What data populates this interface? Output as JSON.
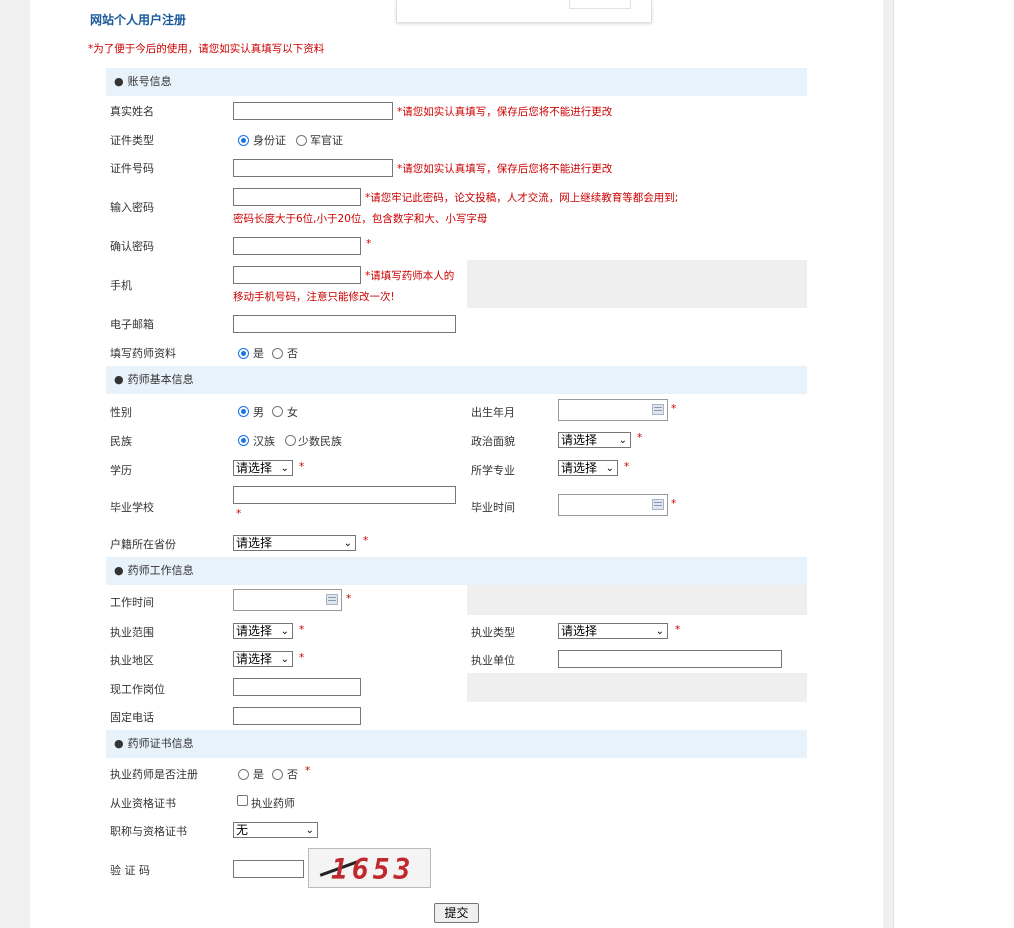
{
  "title": "网站个人用户注册",
  "notice": "*为了便于今后的使用，请您如实认真填写以下资料",
  "sections": {
    "account": "账号信息",
    "basic": "药师基本信息",
    "work": "药师工作信息",
    "cert": "药师证书信息"
  },
  "account": {
    "real_name_label": "真实姓名",
    "real_name_note": "*请您如实认真填写，保存后您将不能进行更改",
    "id_type_label": "证件类型",
    "id_type_options": [
      "身份证",
      "军官证"
    ],
    "id_number_label": "证件号码",
    "id_number_note": "*请您如实认真填写，保存后您将不能进行更改",
    "password_label": "输入密码",
    "password_note_1": "*请您牢记此密码，论文投稿，人才交流，网上继续教育等都会用到;",
    "password_note_2": "密码长度大于6位,小于20位，包含数字和大、小写字母",
    "confirm_label": "确认密码",
    "confirm_note": "*",
    "mobile_label": "手机",
    "mobile_note_1": "*请填写药师本人的",
    "mobile_note_2": "移动手机号码，注意只能修改一次!",
    "email_label": "电子邮箱",
    "pharmacist_info_label": "填写药师资料",
    "pharmacist_info_options": [
      "是",
      "否"
    ]
  },
  "basic": {
    "gender_label": "性别",
    "gender_options": [
      "男",
      "女"
    ],
    "birth_label": "出生年月",
    "ethnic_label": "民族",
    "ethnic_options": [
      "汉族",
      "少数民族"
    ],
    "political_label": "政治面貌",
    "political_value": "请选择",
    "education_label": "学历",
    "education_value": "请选择",
    "major_label": "所学专业",
    "major_value": "请选择",
    "school_label": "毕业学校",
    "grad_time_label": "毕业时间",
    "province_label": "户籍所在省份",
    "province_value": "请选择",
    "star": "*"
  },
  "work": {
    "work_time_label": "工作时间",
    "scope_label": "执业范围",
    "scope_value": "请选择",
    "type_label": "执业类型",
    "type_value": "请选择",
    "region_label": "执业地区",
    "region_value": "请选择",
    "unit_label": "执业单位",
    "position_label": "现工作岗位",
    "phone_label": "固定电话"
  },
  "cert": {
    "registered_label": "执业药师是否注册",
    "registered_options": [
      "是",
      "否"
    ],
    "qualification_label": "从业资格证书",
    "qualification_option": "执业药师",
    "title_label": "职称与资格证书",
    "title_value": "无",
    "captcha_label": "验  证  码",
    "captcha_text": "1653"
  },
  "submit_label": "提交",
  "colors": {
    "section_bg": "#e8f2fb",
    "title": "#1a5a9c",
    "required": "#cc0000",
    "radio_selected": "#1a73e8"
  }
}
